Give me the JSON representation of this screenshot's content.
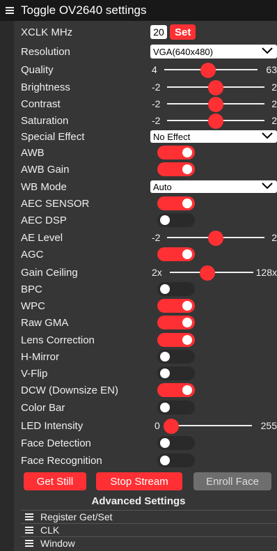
{
  "header": {
    "title": "Toggle OV2640 settings"
  },
  "xclk": {
    "label": "XCLK MHz",
    "value": "20",
    "set_label": "Set"
  },
  "resolution": {
    "label": "Resolution",
    "value": "VGA(640x480)"
  },
  "quality": {
    "label": "Quality",
    "min": "4",
    "max": "63",
    "level": 0.47
  },
  "brightness": {
    "label": "Brightness",
    "min": "-2",
    "max": "2",
    "level": 0.5
  },
  "contrast": {
    "label": "Contrast",
    "min": "-2",
    "max": "2",
    "level": 0.5
  },
  "saturation": {
    "label": "Saturation",
    "min": "-2",
    "max": "2",
    "level": 0.5
  },
  "special_effect": {
    "label": "Special Effect",
    "value": "No Effect"
  },
  "awb": {
    "label": "AWB",
    "on": true
  },
  "awb_gain": {
    "label": "AWB Gain",
    "on": true
  },
  "wb_mode": {
    "label": "WB Mode",
    "value": "Auto"
  },
  "aec_sensor": {
    "label": "AEC SENSOR",
    "on": true
  },
  "aec_dsp": {
    "label": "AEC DSP",
    "on": false
  },
  "ae_level": {
    "label": "AE Level",
    "min": "-2",
    "max": "2",
    "level": 0.5
  },
  "agc": {
    "label": "AGC",
    "on": true
  },
  "gain_ceiling": {
    "label": "Gain Ceiling",
    "min": "2x",
    "max": "128x",
    "level": 0.45
  },
  "bpc": {
    "label": "BPC",
    "on": false
  },
  "wpc": {
    "label": "WPC",
    "on": true
  },
  "raw_gma": {
    "label": "Raw GMA",
    "on": true
  },
  "lens_correction": {
    "label": "Lens Correction",
    "on": true
  },
  "hmirror": {
    "label": "H-Mirror",
    "on": false
  },
  "vflip": {
    "label": "V-Flip",
    "on": false
  },
  "dcw": {
    "label": "DCW (Downsize EN)",
    "on": true
  },
  "color_bar": {
    "label": "Color Bar",
    "on": false
  },
  "led_intensity": {
    "label": "LED Intensity",
    "min": "0",
    "max": "255",
    "level": 0.0
  },
  "face_detection": {
    "label": "Face Detection",
    "on": false
  },
  "face_recognition": {
    "label": "Face Recognition",
    "on": false
  },
  "buttons": {
    "get_still": "Get Still",
    "stop_stream": "Stop Stream",
    "enroll_face": "Enroll Face"
  },
  "advanced": {
    "title": "Advanced Settings",
    "sections": [
      "Register Get/Set",
      "CLK",
      "Window"
    ]
  },
  "colors": {
    "accent": "#ff3034",
    "panel": "#363636",
    "header": "#181818"
  }
}
